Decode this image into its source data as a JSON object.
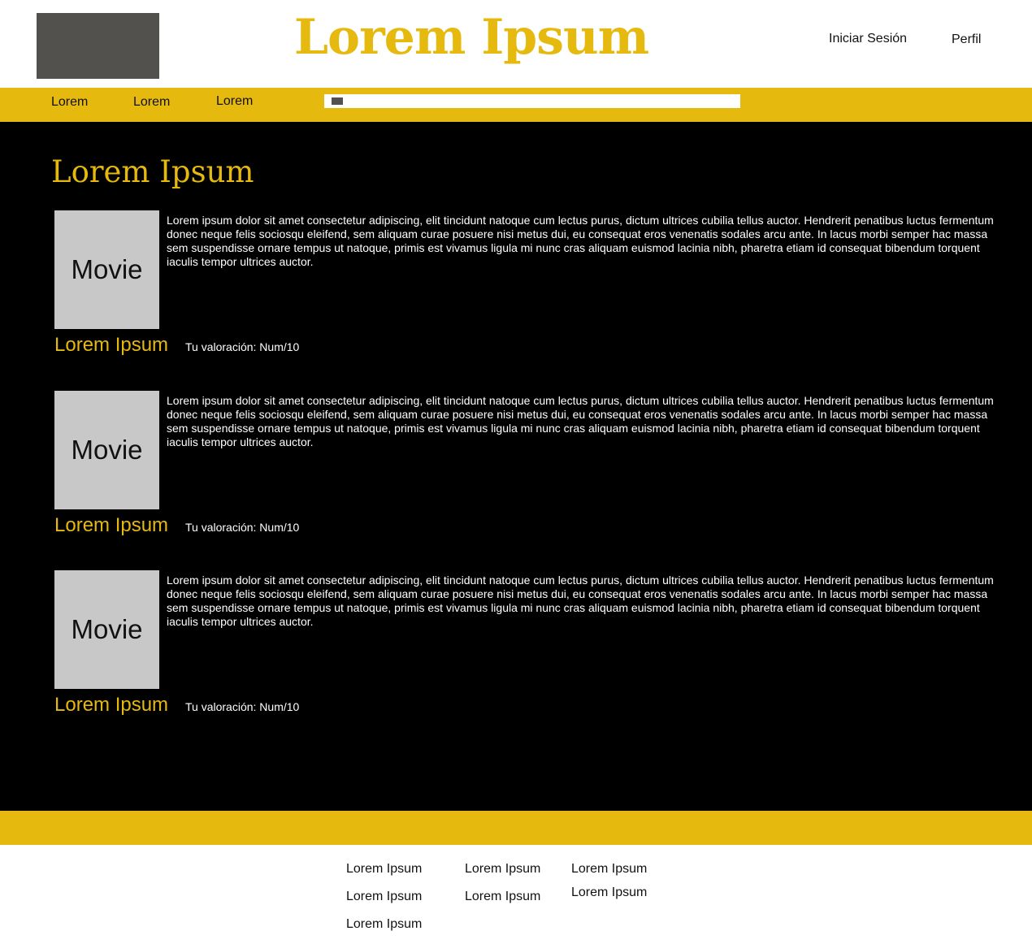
{
  "header": {
    "title": "Lorem Ipsum",
    "login_label": "Iniciar Sesión",
    "profile_label": "Perfil"
  },
  "nav": {
    "items": [
      {
        "label": "Lorem"
      },
      {
        "label": "Lorem"
      },
      {
        "label": "Lorem"
      }
    ],
    "search": {
      "placeholder": "",
      "value": ""
    }
  },
  "main": {
    "section_title": "Lorem Ipsum",
    "movies": [
      {
        "poster_label": "Movie",
        "synopsis": "Lorem ipsum dolor sit amet consectetur adipiscing, elit tincidunt natoque cum lectus purus, dictum ultrices cubilia tellus auctor. Hendrerit penatibus luctus fermentum donec neque felis sociosqu eleifend, sem aliquam curae posuere nisi metus dui, eu consequat eros venenatis sodales arcu ante. In lacus morbi semper hac massa sem suspendisse ornare tempus ut natoque, primis est vivamus ligula mi nunc cras aliquam euismod lacinia nibh, pharetra etiam id consequat bibendum torquent iaculis tempor ultrices auctor.",
        "title": "Lorem Ipsum",
        "rating": "Tu valoración: Num/10"
      },
      {
        "poster_label": "Movie",
        "synopsis": "Lorem ipsum dolor sit amet consectetur adipiscing, elit tincidunt natoque cum lectus purus, dictum ultrices cubilia tellus auctor. Hendrerit penatibus luctus fermentum donec neque felis sociosqu eleifend, sem aliquam curae posuere nisi metus dui, eu consequat eros venenatis sodales arcu ante. In lacus morbi semper hac massa sem suspendisse ornare tempus ut natoque, primis est vivamus ligula mi nunc cras aliquam euismod lacinia nibh, pharetra etiam id consequat bibendum torquent iaculis tempor ultrices auctor.",
        "title": "Lorem Ipsum",
        "rating": "Tu valoración: Num/10"
      },
      {
        "poster_label": "Movie",
        "synopsis": "Lorem ipsum dolor sit amet consectetur adipiscing, elit tincidunt natoque cum lectus purus, dictum ultrices cubilia tellus auctor. Hendrerit penatibus luctus fermentum donec neque felis sociosqu eleifend, sem aliquam curae posuere nisi metus dui, eu consequat eros venenatis sodales arcu ante. In lacus morbi semper hac massa sem suspendisse ornare tempus ut natoque, primis est vivamus ligula mi nunc cras aliquam euismod lacinia nibh, pharetra etiam id consequat bibendum torquent iaculis tempor ultrices auctor.",
        "title": "Lorem Ipsum",
        "rating": "Tu valoración: Num/10"
      }
    ]
  },
  "footer": {
    "columns": [
      {
        "links": [
          "Lorem Ipsum",
          "Lorem Ipsum",
          "Lorem Ipsum"
        ]
      },
      {
        "links": [
          "Lorem Ipsum",
          "Lorem Ipsum"
        ]
      },
      {
        "links": [
          "Lorem Ipsum",
          "Lorem Ipsum"
        ]
      }
    ]
  },
  "colors": {
    "accent": "#e6b90e",
    "main_background": "#000000",
    "logo_placeholder": "#53514e",
    "poster_placeholder": "#c8c8c8"
  }
}
